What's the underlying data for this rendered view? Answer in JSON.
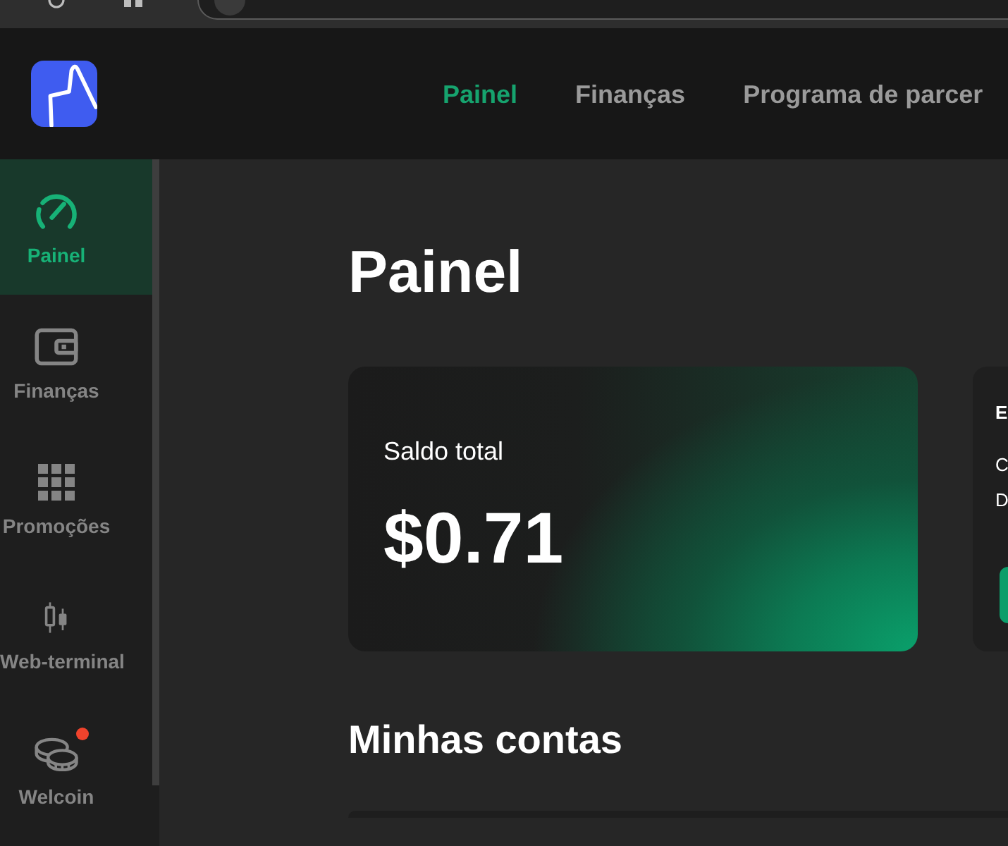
{
  "header": {
    "nav": [
      {
        "label": "Painel",
        "selected": true
      },
      {
        "label": "Finanças",
        "selected": false
      },
      {
        "label": "Programa de parcer",
        "selected": false
      }
    ]
  },
  "sidebar": {
    "items": [
      {
        "label": "Painel",
        "selected": true,
        "notification": false
      },
      {
        "label": "Finanças",
        "selected": false,
        "notification": false
      },
      {
        "label": "Promoções",
        "selected": false,
        "notification": false
      },
      {
        "label": "Web-terminal",
        "selected": false,
        "notification": false
      },
      {
        "label": "Welcoin",
        "selected": false,
        "notification": true
      }
    ]
  },
  "page": {
    "title": "Painel"
  },
  "balance_card": {
    "label": "Saldo total",
    "amount": "$0.71"
  },
  "side_card": {
    "title": "E",
    "lines": [
      "C",
      "D"
    ]
  },
  "section": {
    "title": "Minhas contas"
  }
}
